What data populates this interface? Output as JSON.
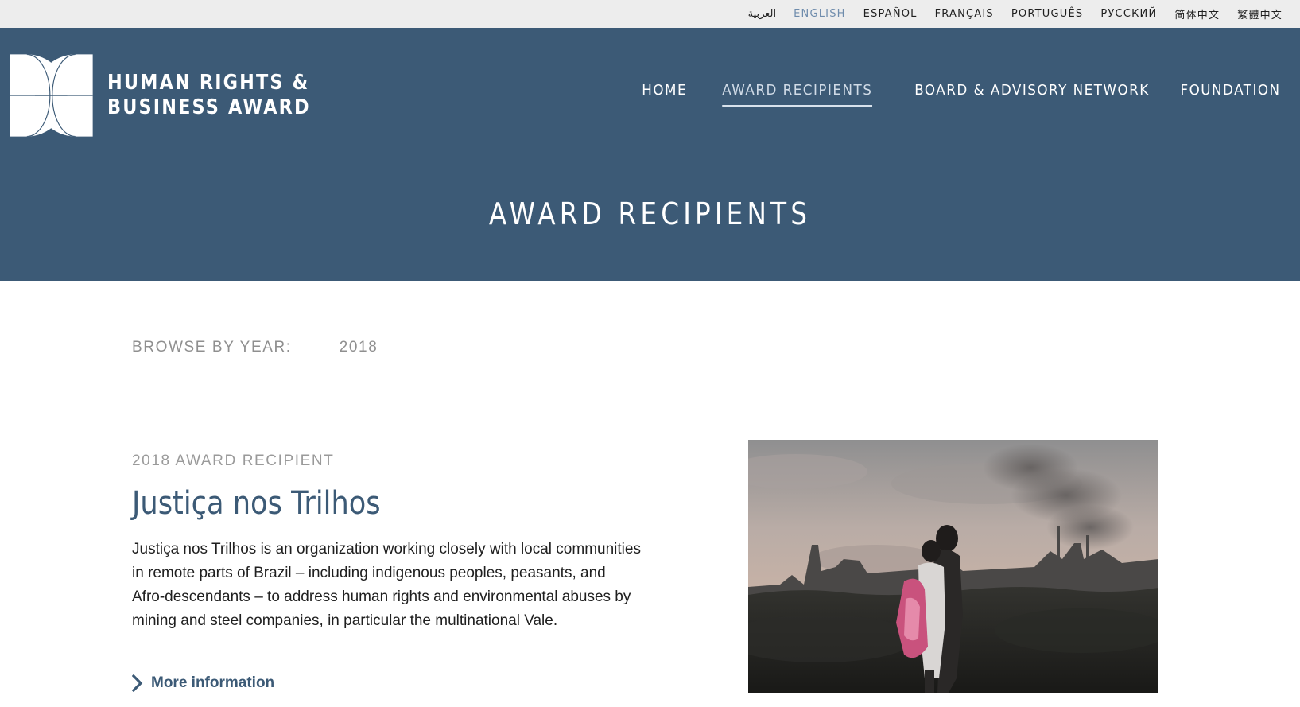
{
  "languages": [
    {
      "label": "العربية",
      "active": false
    },
    {
      "label": "ENGLISH",
      "active": true
    },
    {
      "label": "ESPAÑOL",
      "active": false
    },
    {
      "label": "FRANÇAIS",
      "active": false
    },
    {
      "label": "PORTUGUÊS",
      "active": false
    },
    {
      "label": "РУССКИЙ",
      "active": false
    },
    {
      "label": "简体中文",
      "active": false
    },
    {
      "label": "繁體中文",
      "active": false
    }
  ],
  "logo": {
    "line1": "HUMAN RIGHTS &",
    "line2": "BUSINESS AWARD"
  },
  "nav": [
    {
      "label": "HOME",
      "active": false
    },
    {
      "label": "AWARD RECIPIENTS",
      "active": true
    },
    {
      "label": "BOARD & ADVISORY NETWORK",
      "active": false
    },
    {
      "label": "FOUNDATION",
      "active": false
    }
  ],
  "hero": {
    "title": "AWARD RECIPIENTS"
  },
  "browse": {
    "label": "BROWSE BY YEAR:",
    "year": "2018"
  },
  "recipient": {
    "kicker": "2018 AWARD RECIPIENT",
    "name": "Justiça nos Trilhos",
    "description": "Justiça nos Trilhos is an organization working closely with local communities in remote parts of Brazil – including indigenous peoples, peasants, and Afro-descendants – to address human rights and environmental abuses by mining and steel companies, in particular the multinational Vale.",
    "more_label": "More information"
  },
  "colors": {
    "header_bg": "#3c5a76",
    "lang_bar_bg": "#ededed",
    "active_lang": "#6f8cac",
    "accent": "#3c5a76"
  }
}
